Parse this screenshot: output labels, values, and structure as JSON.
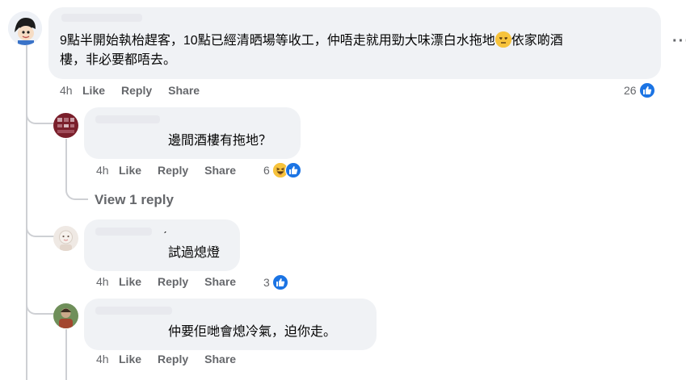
{
  "main_comment": {
    "text": "9點半開始執枱趕客，10點已經清晒場等收工，仲唔走就用勁大味漂白水拖地",
    "text_after_emoji": "依家啲酒",
    "text_line2": "樓，非必要都唔去。",
    "emoji": "unamused-face-icon",
    "time": "4h",
    "like_label": "Like",
    "reply_label": "Reply",
    "share_label": "Share",
    "reaction_count": "26",
    "more_label": "···"
  },
  "replies": [
    {
      "text": "邊間酒樓有拖地？",
      "time": "4h",
      "like_label": "Like",
      "reply_label": "Reply",
      "share_label": "Share",
      "reaction_count": "6",
      "reactions": [
        "haha-icon",
        "like-icon"
      ]
    },
    {
      "text": "試過熄燈",
      "mark": "ˊ",
      "time": "4h",
      "like_label": "Like",
      "reply_label": "Reply",
      "share_label": "Share",
      "reaction_count": "3",
      "reactions": [
        "like-icon"
      ]
    },
    {
      "text": "仲要佢哋會熄冷氣，迫你走。",
      "time": "4h",
      "like_label": "Like",
      "reply_label": "Reply",
      "share_label": "Share"
    }
  ],
  "view_replies_label": "View 1 reply",
  "colors": {
    "bubble": "#f0f2f5",
    "meta_text": "#65676b",
    "like_blue": "#1b74e4",
    "thread_line": "#ced0d4"
  }
}
